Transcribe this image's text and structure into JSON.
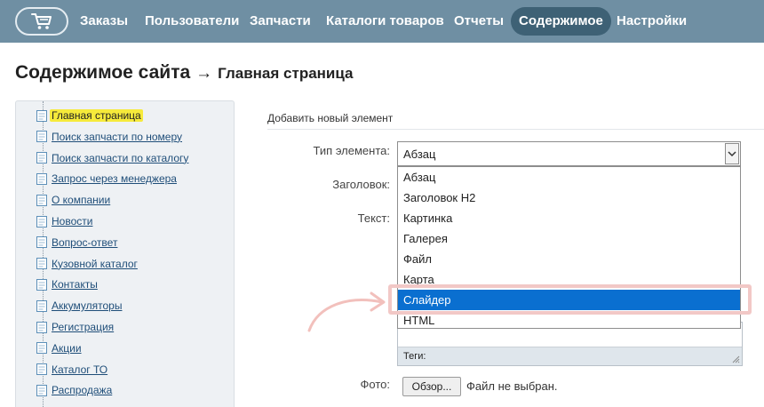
{
  "nav": {
    "cart_icon": "cart-icon",
    "items": [
      {
        "label": "Заказы",
        "active": false
      },
      {
        "label": "Пользователи",
        "active": false
      },
      {
        "label": "Запчасти",
        "active": false
      },
      {
        "label": "Каталоги товаров",
        "active": false
      },
      {
        "label": "Отчеты",
        "active": false
      },
      {
        "label": "Содержимое",
        "active": true
      },
      {
        "label": "Настройки",
        "active": false
      }
    ],
    "colors": {
      "bar": "#6f8fa3",
      "active": "#3e6175"
    }
  },
  "heading": {
    "main": "Содержимое сайта",
    "arrow": "→",
    "sub": "Главная страница"
  },
  "sidebar": {
    "items": [
      {
        "label": "Главная страница",
        "selected": true
      },
      {
        "label": "Поиск запчасти по номеру",
        "selected": false
      },
      {
        "label": "Поиск запчасти по каталогу",
        "selected": false
      },
      {
        "label": "Запрос через менеджера",
        "selected": false
      },
      {
        "label": "О компании",
        "selected": false
      },
      {
        "label": "Новости",
        "selected": false
      },
      {
        "label": "Вопрос-ответ",
        "selected": false
      },
      {
        "label": "Кузовной каталог",
        "selected": false
      },
      {
        "label": "Контакты",
        "selected": false
      },
      {
        "label": "Аккумуляторы",
        "selected": false
      },
      {
        "label": "Регистрация",
        "selected": false
      },
      {
        "label": "Акции",
        "selected": false
      },
      {
        "label": "Каталог ТО",
        "selected": false
      },
      {
        "label": "Распродажа",
        "selected": false
      }
    ]
  },
  "form": {
    "title": "Добавить новый элемент",
    "type_label": "Тип элемента:",
    "heading_label": "Заголовок:",
    "text_label": "Текст:",
    "photo_label": "Фото:",
    "type_select": {
      "value": "Абзац",
      "options": [
        "Абзац",
        "Заголовок H2",
        "Картинка",
        "Галерея",
        "Файл",
        "Карта",
        "Слайдер",
        "HTML"
      ],
      "highlighted": "Слайдер"
    },
    "tags_label": "Теги:",
    "browse_button": "Обзор...",
    "no_file": "Файл не выбран."
  },
  "annotation": {
    "color": "#f2c8c6"
  }
}
